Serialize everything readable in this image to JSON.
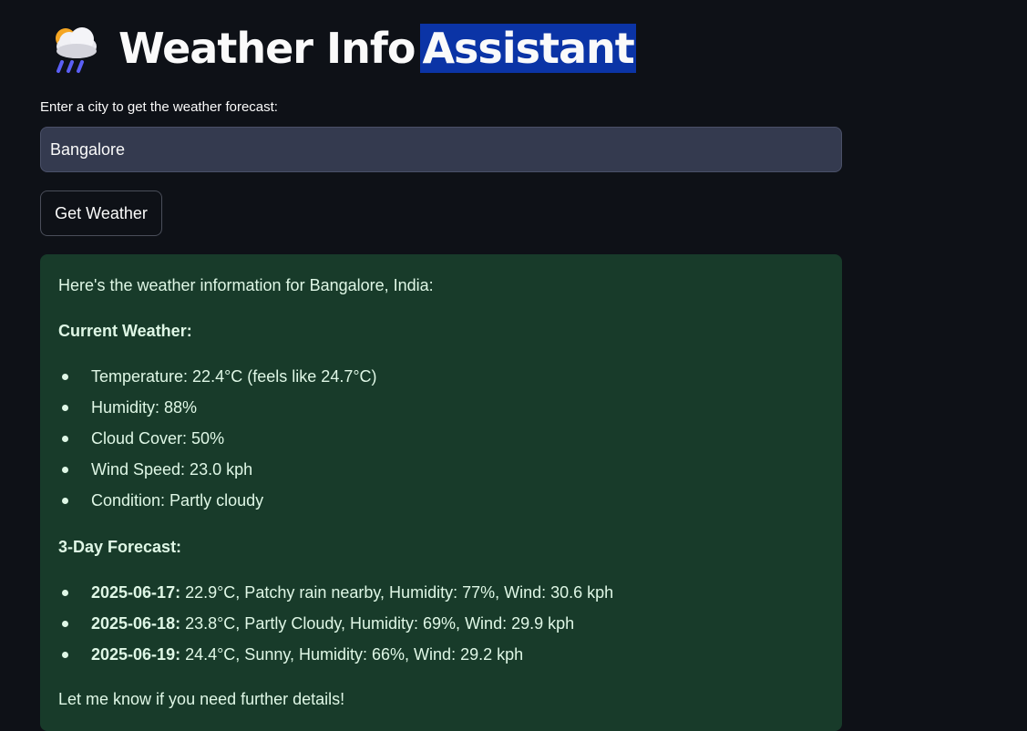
{
  "app": {
    "title_main": "Weather Info",
    "title_highlight": "Assistant",
    "icon": "cloud-rain-sun-icon"
  },
  "form": {
    "label": "Enter a city to get the weather forecast:",
    "city_value": "Bangalore",
    "button_label": "Get Weather"
  },
  "result": {
    "intro": "Here's the weather information for Bangalore, India:",
    "current_heading": "Current Weather:",
    "current_items": [
      "Temperature: 22.4°C (feels like 24.7°C)",
      "Humidity: 88%",
      "Cloud Cover: 50%",
      "Wind Speed: 23.0 kph",
      "Condition: Partly cloudy"
    ],
    "forecast_heading": "3-Day Forecast:",
    "forecast_items": [
      {
        "date": "2025-06-17:",
        "text": " 22.9°C, Patchy rain nearby, Humidity: 77%, Wind: 30.6 kph"
      },
      {
        "date": "2025-06-18:",
        "text": " 23.8°C, Partly Cloudy, Humidity: 69%, Wind: 29.9 kph"
      },
      {
        "date": "2025-06-19:",
        "text": " 24.4°C, Sunny, Humidity: 66%, Wind: 29.2 kph"
      }
    ],
    "closing": "Let me know if you need further details!"
  },
  "colors": {
    "background": "#0e1117",
    "highlight": "#0b34a6",
    "input_bg": "#343a4f",
    "result_bg": "#183b2a",
    "result_text": "#dff7e6"
  }
}
